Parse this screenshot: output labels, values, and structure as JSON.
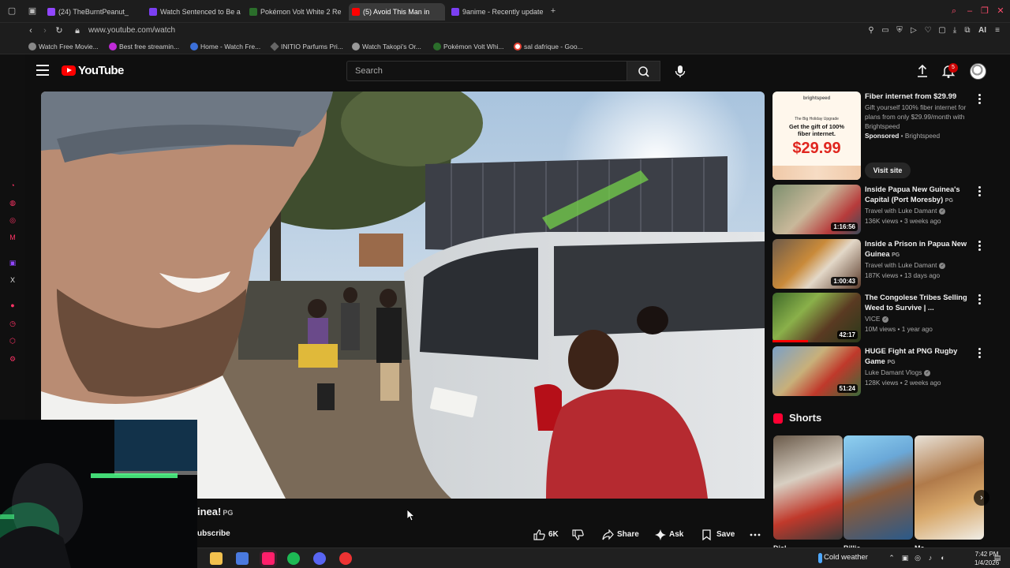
{
  "browser": {
    "tabs": [
      {
        "label": "(24) TheBurntPeanut_",
        "icon_color": "#9146ff"
      },
      {
        "label": "Watch Sentenced to Be a",
        "icon_color": "#7b3ff2"
      },
      {
        "label": "Pokémon Volt White 2 Re",
        "icon_color": "#2b6e2b"
      },
      {
        "label": "(5) Avoid This Man in",
        "icon_color": "#ff0000"
      },
      {
        "label": "9anime - Recently update",
        "icon_color": "#7b3ff2"
      }
    ],
    "url": "www.youtube.com/watch",
    "bookmarks": [
      {
        "label": "Watch Free Movie...",
        "color": "#888888"
      },
      {
        "label": "Best free streamin...",
        "color": "#c02bd8"
      },
      {
        "label": "Home - Watch Fre...",
        "color": "#3b6fd8"
      },
      {
        "label": "INITIO Parfums Pri...",
        "color": "#666666"
      },
      {
        "label": "Watch Takopi's Or...",
        "color": "#999999"
      },
      {
        "label": "Pokémon Volt Whi...",
        "color": "#2b6e2b"
      },
      {
        "label": "sal dafrique - Goo...",
        "color": "#ffffff"
      }
    ],
    "extension_ai_label": "AI"
  },
  "youtube": {
    "logo_text": "YouTube",
    "search_placeholder": "Search",
    "notification_count": "5",
    "video": {
      "title_fragment": "inea!",
      "rating": "PG",
      "subscribe_fragment": "ubscribe",
      "likes": "6K",
      "share_label": "Share",
      "ask_label": "Ask",
      "save_label": "Save"
    },
    "ad": {
      "title": "Fiber internet from $29.99",
      "description": "Gift yourself 100% fiber internet for plans from only $29.99/month with Brightspeed",
      "sponsored_label": "Sponsored",
      "advertiser": "Brightspeed",
      "cta": "Visit site",
      "thumb_brand": "brightspeed",
      "thumb_kicker": "The Big Holiday Upgrade",
      "thumb_headline": "Get the gift of 100% fiber internet.",
      "thumb_price": "$29.99"
    },
    "recommendations": [
      {
        "title": "Inside Papua New Guinea's Capital (Port Moresby)",
        "rating": "PG",
        "channel": "Travel with Luke Damant",
        "meta": "136K views • 3 weeks ago",
        "duration": "1:16:56"
      },
      {
        "title": "Inside a Prison in Papua New Guinea",
        "rating": "PG",
        "channel": "Travel with Luke Damant",
        "meta": "187K views • 13 days ago",
        "duration": "1:00:43"
      },
      {
        "title": "The Congolese Tribes Selling Weed to Survive | ...",
        "rating": "",
        "channel": "VICE",
        "meta": "10M views • 1 year ago",
        "duration": "42:17"
      },
      {
        "title": "HUGE Fight at PNG Rugby Game",
        "rating": "PG",
        "channel": "Luke Damant Vlogs",
        "meta": "128K views • 2 weeks ago",
        "duration": "51:24"
      }
    ],
    "shorts_heading": "Shorts",
    "shorts_caption_fragments": [
      "Dial",
      "Billie",
      "Me"
    ]
  },
  "taskbar": {
    "weather": "Cold weather",
    "time": "7:42 PM",
    "date": "1/4/2026"
  },
  "colors": {
    "background": "#0f0f0f",
    "accent": "#ff0000",
    "browser_accent": "#ff3366"
  }
}
